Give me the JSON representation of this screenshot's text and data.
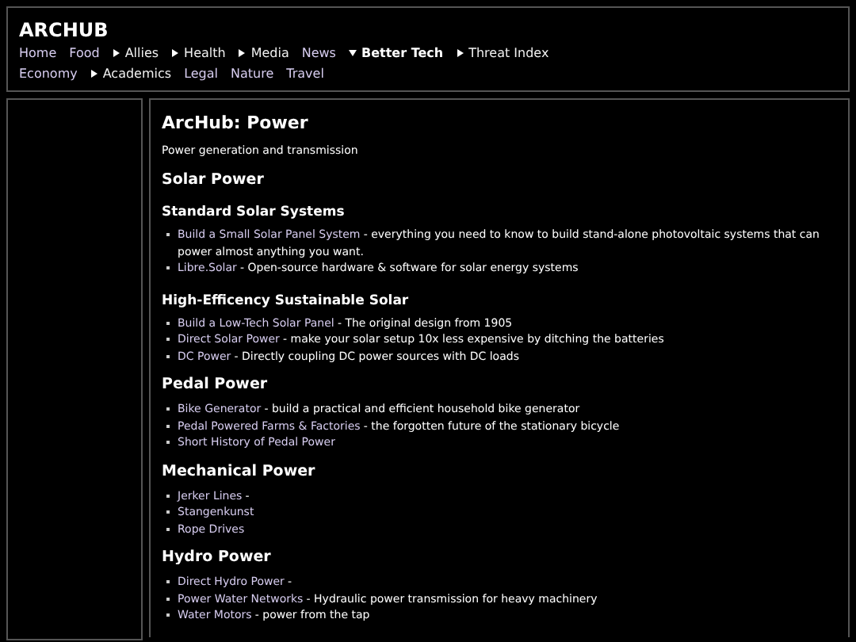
{
  "site_title": "ARCHUB",
  "nav": [
    {
      "label": "Home",
      "kind": "link"
    },
    {
      "label": "Food",
      "kind": "link"
    },
    {
      "label": "Allies",
      "kind": "menu",
      "expanded": false
    },
    {
      "label": "Health",
      "kind": "menu",
      "expanded": false
    },
    {
      "label": "Media",
      "kind": "menu",
      "expanded": false
    },
    {
      "label": "News",
      "kind": "link"
    },
    {
      "label": "Better Tech",
      "kind": "menu",
      "expanded": true
    },
    {
      "label": "Threat Index",
      "kind": "menu",
      "expanded": false
    },
    {
      "label": "Economy",
      "kind": "link"
    },
    {
      "label": "Academics",
      "kind": "menu",
      "expanded": false
    },
    {
      "label": "Legal",
      "kind": "link"
    },
    {
      "label": "Nature",
      "kind": "link"
    },
    {
      "label": "Travel",
      "kind": "link"
    }
  ],
  "page_title": "ArcHub: Power",
  "subtitle": "Power generation and transmission",
  "sections": [
    {
      "heading": "Solar Power",
      "kind": "h2"
    },
    {
      "heading": "Standard Solar Systems",
      "kind": "h3",
      "items": [
        {
          "link": "Build a Small Solar Panel System",
          "text": "- everything you need to know to build stand-alone photovoltaic systems that can power almost anything you want."
        },
        {
          "link": "Libre.Solar",
          "text": "- Open-source hardware & software for solar energy systems"
        }
      ]
    },
    {
      "heading": "High-Efficency Sustainable Solar",
      "kind": "h3",
      "items": [
        {
          "link": "Build a Low-Tech Solar Panel",
          "text": "- The original design from 1905"
        },
        {
          "link": "Direct Solar Power",
          "text": "- make your solar setup 10x less expensive by ditching the batteries"
        },
        {
          "link": "DC Power",
          "text": "- Directly coupling DC power sources with DC loads"
        }
      ]
    },
    {
      "heading": "Pedal Power",
      "kind": "h2",
      "items": [
        {
          "link": "Bike Generator",
          "text": "- build a practical and efficient household bike generator"
        },
        {
          "link": "Pedal Powered Farms & Factories",
          "text": "- the forgotten future of the stationary bicycle"
        },
        {
          "link": "Short History of Pedal Power"
        }
      ]
    },
    {
      "heading": "Mechanical Power",
      "kind": "h2",
      "items": [
        {
          "link": "Jerker Lines",
          "text": "-"
        },
        {
          "link": "Stangenkunst"
        },
        {
          "link": "Rope Drives"
        }
      ]
    },
    {
      "heading": "Hydro Power",
      "kind": "h2",
      "items": [
        {
          "link": "Direct Hydro Power",
          "text": "-"
        },
        {
          "link": "Power Water Networks",
          "text": "- Hydraulic power transmission for heavy machinery"
        },
        {
          "link": "Water Motors",
          "text": "- power from the tap"
        }
      ]
    }
  ]
}
